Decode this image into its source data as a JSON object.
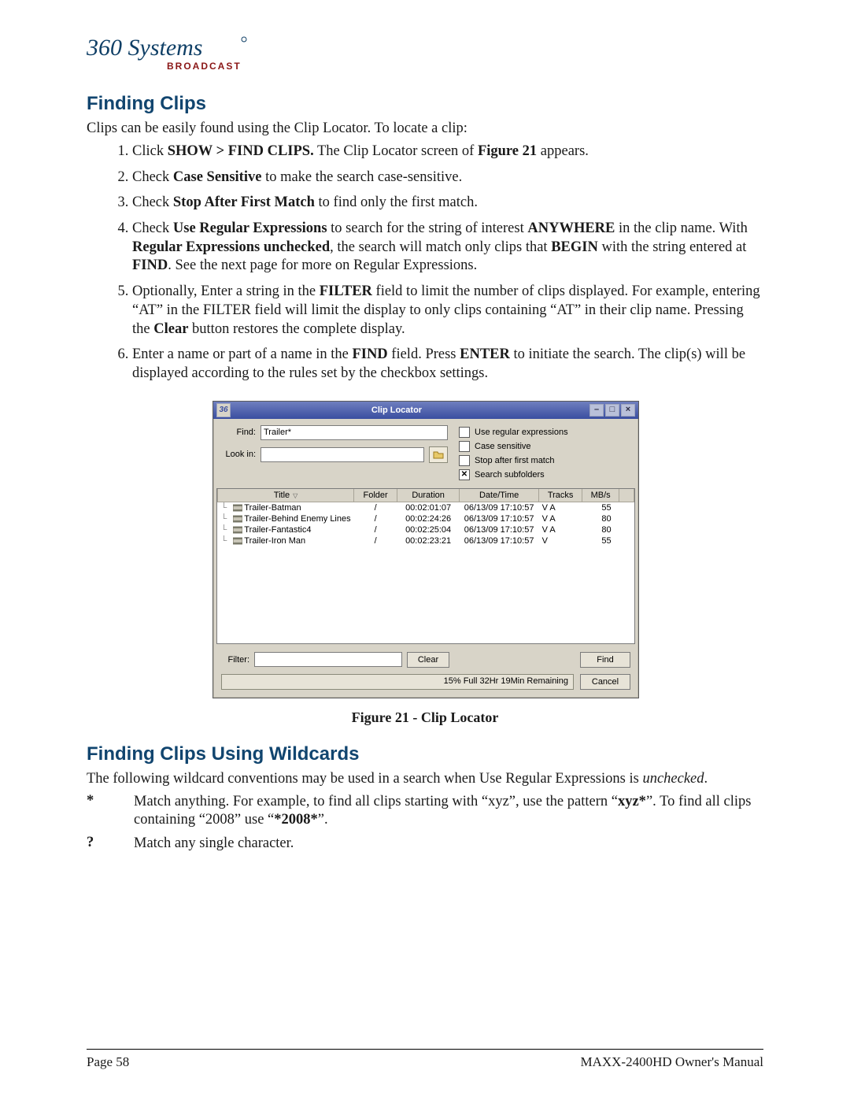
{
  "logo": {
    "brand": "360 Systems",
    "sub": "BROADCAST"
  },
  "section1_heading": "Finding Clips",
  "intro_line": "Clips can be easily found using the Clip Locator. To locate a clip:",
  "steps": {
    "s1_a": "Click ",
    "s1_b": "SHOW > FIND CLIPS.",
    "s1_c": " The Clip Locator screen of ",
    "s1_d": "Figure 21",
    "s1_e": " appears.",
    "s2_a": "Check ",
    "s2_b": "Case Sensitive",
    "s2_c": " to make the search case-sensitive.",
    "s3_a": "Check ",
    "s3_b": "Stop After First Match",
    "s3_c": " to find only the first match.",
    "s4_a": "Check ",
    "s4_b": "Use Regular Expressions",
    "s4_c": " to search for the string of interest ",
    "s4_d": "ANYWHERE",
    "s4_e": " in the clip name. With ",
    "s4_f": "Regular Expressions unchecked",
    "s4_g": ", the search will match only clips that ",
    "s4_h": "BEGIN",
    "s4_i": " with the string entered at ",
    "s4_j": "FIND",
    "s4_k": ". See the next page for more on Regular Expressions.",
    "s5_a": "Optionally, Enter a string in the ",
    "s5_b": "FILTER",
    "s5_c": " field to limit the number of clips displayed. For example, entering “AT” in the FILTER field will limit the display to only clips containing “AT” in their clip name. Pressing the ",
    "s5_d": "Clear",
    "s5_e": " button restores the complete display.",
    "s6_a": "Enter a name or part of a name in the ",
    "s6_b": "FIND",
    "s6_c": " field. Press ",
    "s6_d": "ENTER",
    "s6_e": " to initiate the search. The clip(s) will be displayed according to the rules set by the checkbox settings."
  },
  "cl": {
    "title": "Clip Locator",
    "find_label": "Find:",
    "find_value": "Trailer*",
    "lookin_label": "Look in:",
    "lookin_value": "",
    "chk_regex": "Use regular expressions",
    "chk_case": "Case sensitive",
    "chk_stop": "Stop after first match",
    "chk_subfolders": "Search subfolders",
    "cols": {
      "title": "Title",
      "folder": "Folder",
      "duration": "Duration",
      "datetime": "Date/Time",
      "tracks": "Tracks",
      "mbs": "MB/s"
    },
    "rows": [
      {
        "title": "Trailer-Batman",
        "folder": "/",
        "duration": "00:02:01:07",
        "datetime": "06/13/09 17:10:57",
        "tracks": "V A",
        "mbs": "55"
      },
      {
        "title": "Trailer-Behind Enemy Lines",
        "folder": "/",
        "duration": "00:02:24:26",
        "datetime": "06/13/09 17:10:57",
        "tracks": "V A",
        "mbs": "80"
      },
      {
        "title": "Trailer-Fantastic4",
        "folder": "/",
        "duration": "00:02:25:04",
        "datetime": "06/13/09 17:10:57",
        "tracks": "V A",
        "mbs": "80"
      },
      {
        "title": "Trailer-Iron Man",
        "folder": "/",
        "duration": "00:02:23:21",
        "datetime": "06/13/09 17:10:57",
        "tracks": "V",
        "mbs": "55"
      }
    ],
    "filter_label": "Filter:",
    "filter_value": "",
    "btn_clear": "Clear",
    "btn_find": "Find",
    "btn_cancel": "Cancel",
    "status": "15% Full 32Hr 19Min Remaining"
  },
  "fig_caption": "Figure 21 - Clip Locator",
  "section2_heading": "Finding Clips Using Wildcards",
  "section2_intro_a": "The following wildcard conventions may be used in a search when Use Regular Expressions is ",
  "section2_intro_b": "unchecked",
  "section2_intro_c": ".",
  "wc": {
    "star_sym": "*",
    "star_a": "Match anything.  For example, to find all clips starting with “xyz”, use the pattern “",
    "star_b": "xyz*",
    "star_c": "”. To find all clips containing “2008” use “",
    "star_d": "*2008*",
    "star_e": "”.",
    "q_sym": "?",
    "q_desc": "Match any single character."
  },
  "footer": {
    "left": "Page 58",
    "right": "MAXX-2400HD Owner's Manual"
  }
}
